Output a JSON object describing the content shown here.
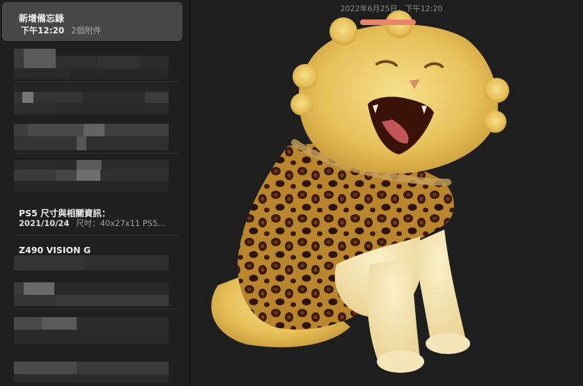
{
  "sidebar": {
    "selected_note": {
      "title": "新增備忘錄",
      "time": "下午12:20",
      "attachments": "2個附件"
    },
    "notes": [
      {
        "title": "PS5 尺寸與相關資訊：",
        "date": "2021/10/24",
        "preview": "尺吋：40x27x11 PS5..."
      },
      {
        "title": "Z490 VISION G"
      }
    ]
  },
  "editor": {
    "timestamp": "2022年6月25日，下午12:20",
    "image_icon": "cat-photo"
  },
  "colors": {
    "background": "#1e1e1e",
    "selected_row": "#474747",
    "sidebar": "#1f1f1f"
  }
}
